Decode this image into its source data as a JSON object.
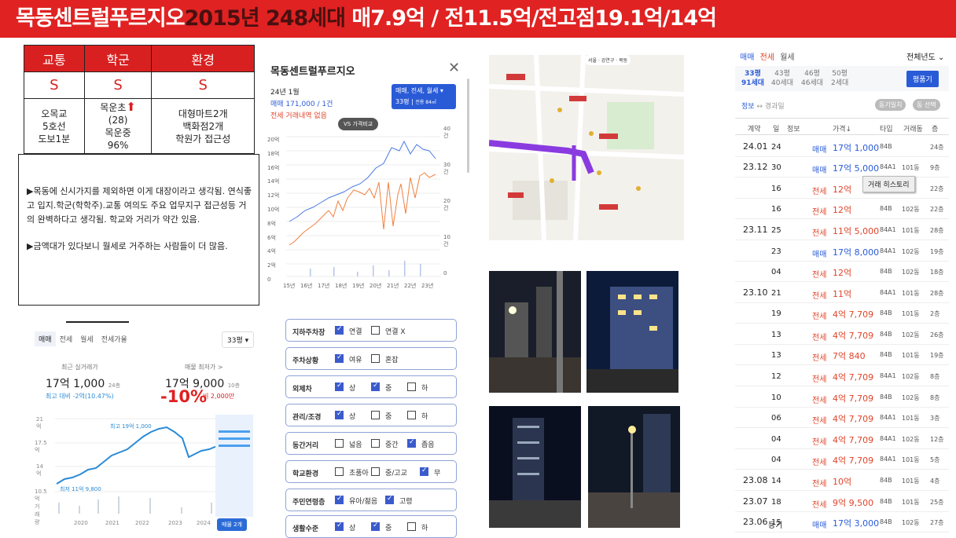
{
  "banner": {
    "name": "목동센트럴푸르지오",
    "highlight": "2015년 248세대",
    "rest": " 매7.9억 / 전11.5억/전고점19.1억/14억"
  },
  "ratings": {
    "headers": [
      "교통",
      "학군",
      "환경"
    ],
    "grades": [
      "S",
      "S",
      "S"
    ],
    "transport": [
      "오목교",
      "5호선",
      "도보1분"
    ],
    "school": [
      "목운초",
      "(28)",
      "목운중",
      "96%"
    ],
    "environment": [
      "대형마트2개",
      "백화점2개",
      "학원가 접근성"
    ]
  },
  "note": {
    "p1": "▶목동에 신시가지를 제외하면 이게 대장이라고 생각됨. 연식좋고 입지.학군(학학주).교통 여의도 주요 업무지구 접근성등 거의 완벽하다고 생각됨. 학교와 거리가 약간 있음.",
    "p2": "▶금액대가 있다보니 월세로 거주하는 사람들이 더 많음."
  },
  "price_panel": {
    "tabs": [
      "매매",
      "전세",
      "월세",
      "전세가율"
    ],
    "size": "33평",
    "recent_label": "최근 실거래가",
    "recent_value": "17억 1,000",
    "recent_floor": "24층",
    "recent_change": "최고 대비 -2억(10.47%)",
    "ask_label": "매물 최저가 >",
    "ask_value": "17억 9,000",
    "ask_floor": "10층",
    "discount": "-10%",
    "ask_change": "비 2,000만",
    "max_label": "최고 19억 1,000",
    "min_label": "최저 11억 9,800",
    "y_ticks": [
      "21억",
      "17.5억",
      "14억",
      "10.5억"
    ],
    "volume_label": "거래량",
    "x_ticks": [
      "2020",
      "2021",
      "2022",
      "2023",
      "2024"
    ],
    "listing_btn": "매물 2개"
  },
  "detail": {
    "title": "목동센트럴푸르지오",
    "date": "24년 1월",
    "sale": "매매 171,000 / 1건",
    "rent": "전세 거래내역 없음",
    "filter": "매매, 전세, 월세",
    "filter_size": "33평",
    "filter_area": "전용 84㎡",
    "compare": "VS 가격비교",
    "y_left": [
      "20억",
      "18억",
      "16억",
      "14억",
      "12억",
      "10억",
      "8억",
      "6억",
      "4억",
      "2억",
      "0"
    ],
    "y_right": [
      "40건",
      "30건",
      "20건",
      "10건",
      "0"
    ],
    "x": [
      "15년",
      "16년",
      "17년",
      "18년",
      "19년",
      "20년",
      "21년",
      "22년",
      "23년"
    ]
  },
  "checklist": [
    {
      "label": "지하주차장",
      "opts": [
        [
          "연결",
          true
        ],
        [
          "연결 X",
          false
        ]
      ]
    },
    {
      "label": "주차상황",
      "opts": [
        [
          "여유",
          true
        ],
        [
          "혼잡",
          false
        ]
      ]
    },
    {
      "label": "외제차",
      "opts": [
        [
          "상",
          true
        ],
        [
          "중",
          true
        ],
        [
          "하",
          false
        ]
      ]
    },
    {
      "label": "관리/조경",
      "opts": [
        [
          "상",
          true
        ],
        [
          "중",
          false
        ],
        [
          "하",
          false
        ]
      ]
    },
    {
      "label": "동간거리",
      "opts": [
        [
          "넓음",
          false
        ],
        [
          "중간",
          false
        ],
        [
          "좁음",
          true
        ]
      ]
    },
    {
      "label": "학교환경",
      "opts": [
        [
          "초품아",
          false
        ],
        [
          "중/고교",
          false
        ],
        [
          "무",
          true
        ]
      ]
    },
    {
      "label": "주민연령층",
      "opts": [
        [
          "유아/젊음",
          true
        ],
        [
          "고령",
          true
        ]
      ]
    },
    {
      "label": "생활수준",
      "opts": [
        [
          "상",
          true
        ],
        [
          "중",
          true
        ],
        [
          "하",
          false
        ]
      ]
    }
  ],
  "map": {
    "labels": [
      "서울",
      "강연구",
      "목동"
    ]
  },
  "history": {
    "tabs": [
      "매매",
      "전세",
      "월세"
    ],
    "year_sel": "전체년도",
    "sizes": [
      [
        "33평",
        "91세대"
      ],
      [
        "43평",
        "40세대"
      ],
      [
        "46평",
        "46세대"
      ],
      [
        "50평",
        "2세대"
      ]
    ],
    "pyeong_btn": "평품기",
    "info": "정보",
    "info2": "경과일",
    "btn1": "동기일치",
    "btn2": "동 선택",
    "cols": [
      "계약",
      "일",
      "정보",
      "가격↓",
      "타입",
      "거래동",
      "층"
    ],
    "tooltip": "거래 히스토리",
    "rows": [
      [
        "24.01",
        "24",
        "",
        "매매",
        "17억 1,000",
        "84B",
        "",
        "24층"
      ],
      [
        "23.12",
        "30",
        "",
        "매매",
        "17억 5,000",
        "84A1",
        "101동",
        "9층"
      ],
      [
        "",
        "16",
        "",
        "전세",
        "12억",
        "",
        "",
        "22층"
      ],
      [
        "",
        "16",
        "",
        "전세",
        "12억",
        "84B",
        "102동",
        "22층"
      ],
      [
        "23.11",
        "25",
        "",
        "전세",
        "11억 5,000",
        "84A1",
        "101동",
        "28층"
      ],
      [
        "",
        "23",
        "",
        "매매",
        "17억 8,000",
        "84A1",
        "102동",
        "19층"
      ],
      [
        "",
        "04",
        "",
        "전세",
        "12억",
        "84B",
        "102동",
        "18층"
      ],
      [
        "23.10",
        "21",
        "",
        "전세",
        "11억",
        "84A1",
        "101동",
        "28층"
      ],
      [
        "",
        "19",
        "",
        "전세",
        "4억 7,709",
        "84B",
        "101동",
        "2층"
      ],
      [
        "",
        "13",
        "",
        "전세",
        "4억 7,709",
        "84B",
        "102동",
        "26층"
      ],
      [
        "",
        "13",
        "",
        "전세",
        "7억 840",
        "84B",
        "101동",
        "19층"
      ],
      [
        "",
        "12",
        "",
        "전세",
        "4억 7,709",
        "84A1",
        "102동",
        "8층"
      ],
      [
        "",
        "10",
        "",
        "전세",
        "4억 7,709",
        "84B",
        "102동",
        "8층"
      ],
      [
        "",
        "06",
        "",
        "전세",
        "4억 7,709",
        "84A1",
        "101동",
        "3층"
      ],
      [
        "",
        "04",
        "",
        "전세",
        "4억 7,709",
        "84A1",
        "102동",
        "12층"
      ],
      [
        "",
        "04",
        "",
        "전세",
        "4억 7,709",
        "84A1",
        "101동",
        "5층"
      ],
      [
        "23.08",
        "14",
        "",
        "전세",
        "10억",
        "84B",
        "101동",
        "4층"
      ],
      [
        "23.07",
        "18",
        "",
        "전세",
        "9억 9,500",
        "84B",
        "101동",
        "25층"
      ],
      [
        "23.06",
        "15",
        "등기",
        "매매",
        "17억 3,000",
        "84B",
        "102동",
        "27층"
      ]
    ]
  }
}
